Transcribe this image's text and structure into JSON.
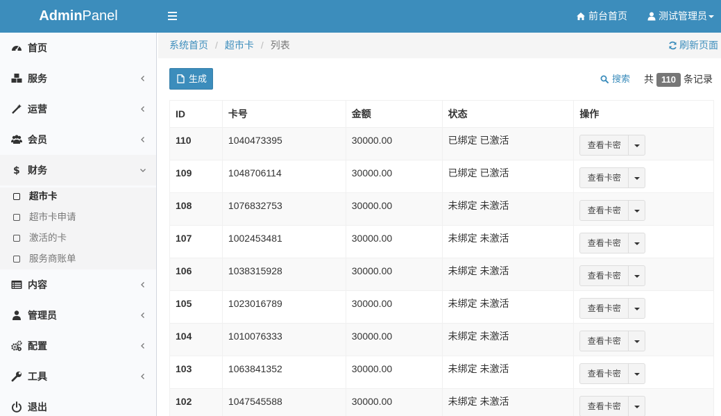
{
  "header": {
    "logo_bold": "Admin",
    "logo_light": "Panel",
    "frontend_link": "前台首页",
    "user_name": "测试管理员"
  },
  "sidebar": {
    "items": [
      {
        "label": "首页",
        "icon": "dashboard-icon"
      },
      {
        "label": "服务",
        "icon": "cubes-icon"
      },
      {
        "label": "运营",
        "icon": "magic-wand-icon"
      },
      {
        "label": "会员",
        "icon": "users-icon"
      },
      {
        "label": "财务",
        "icon": "dollar-icon"
      },
      {
        "label": "内容",
        "icon": "list-icon"
      },
      {
        "label": "管理员",
        "icon": "user-icon"
      },
      {
        "label": "配置",
        "icon": "cogs-icon"
      },
      {
        "label": "工具",
        "icon": "wrench-icon"
      },
      {
        "label": "退出",
        "icon": "power-icon"
      }
    ],
    "finance_sub": [
      {
        "label": "超市卡",
        "active": true
      },
      {
        "label": "超市卡申请",
        "active": false
      },
      {
        "label": "激活的卡",
        "active": false
      },
      {
        "label": "服务商账单",
        "active": false
      }
    ]
  },
  "breadcrumb": {
    "home": "系统首页",
    "section": "超市卡",
    "current": "列表",
    "refresh": "刷新页面"
  },
  "toolbar": {
    "generate": "生成",
    "search": "搜索",
    "count_prefix": "共",
    "count": "110",
    "count_suffix": "条记录"
  },
  "table": {
    "columns": [
      "ID",
      "卡号",
      "金额",
      "状态",
      "操作"
    ],
    "action_label": "查看卡密",
    "rows": [
      {
        "id": "110",
        "card": "1040473395",
        "amount": "30000.00",
        "status": "已绑定 已激活",
        "ok": true
      },
      {
        "id": "109",
        "card": "1048706114",
        "amount": "30000.00",
        "status": "已绑定 已激活",
        "ok": true
      },
      {
        "id": "108",
        "card": "1076832753",
        "amount": "30000.00",
        "status": "未绑定 未激活",
        "ok": false
      },
      {
        "id": "107",
        "card": "1002453481",
        "amount": "30000.00",
        "status": "未绑定 未激活",
        "ok": false
      },
      {
        "id": "106",
        "card": "1038315928",
        "amount": "30000.00",
        "status": "未绑定 未激活",
        "ok": false
      },
      {
        "id": "105",
        "card": "1023016789",
        "amount": "30000.00",
        "status": "未绑定 未激活",
        "ok": false
      },
      {
        "id": "104",
        "card": "1010076333",
        "amount": "30000.00",
        "status": "未绑定 未激活",
        "ok": false
      },
      {
        "id": "103",
        "card": "1063841352",
        "amount": "30000.00",
        "status": "未绑定 未激活",
        "ok": false
      },
      {
        "id": "102",
        "card": "1047545588",
        "amount": "30000.00",
        "status": "未绑定 未激活",
        "ok": false
      }
    ]
  },
  "colors": {
    "primary": "#3c8dbc",
    "success": "#00a65a",
    "danger": "#dd4b39",
    "badge": "#777777"
  }
}
